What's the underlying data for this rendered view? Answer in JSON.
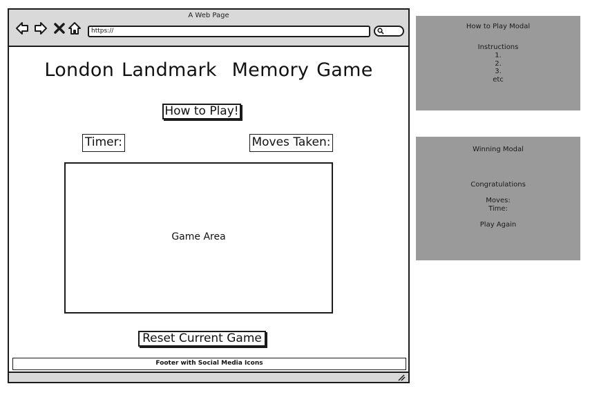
{
  "browser": {
    "title": "A Web Page",
    "url": "https://",
    "nav_icons": [
      "back-arrow-icon",
      "forward-arrow-icon",
      "close-x-icon",
      "home-icon"
    ],
    "search_icon": "search-icon"
  },
  "page": {
    "title": "London Landmark  Memory Game",
    "how_to_button": "How to Play!",
    "timer_label": "Timer:",
    "moves_label": "Moves Taken:",
    "game_area_label": "Game Area",
    "reset_button": "Reset Current Game",
    "footer": "Footer with Social Media Icons"
  },
  "modals": {
    "how_to_play": {
      "title": "How to Play Modal",
      "heading": "Instructions",
      "items": [
        "1.",
        "2.",
        "3.",
        "etc"
      ]
    },
    "winning": {
      "title": "Winning Modal",
      "heading": "Congratulations",
      "moves_label": "Moves:",
      "time_label": "Time:",
      "play_again": "Play Again"
    }
  },
  "colors": {
    "chrome": "#d9d9d9",
    "modal_bg": "#9a9a9a",
    "stroke": "#1a1a1a"
  }
}
